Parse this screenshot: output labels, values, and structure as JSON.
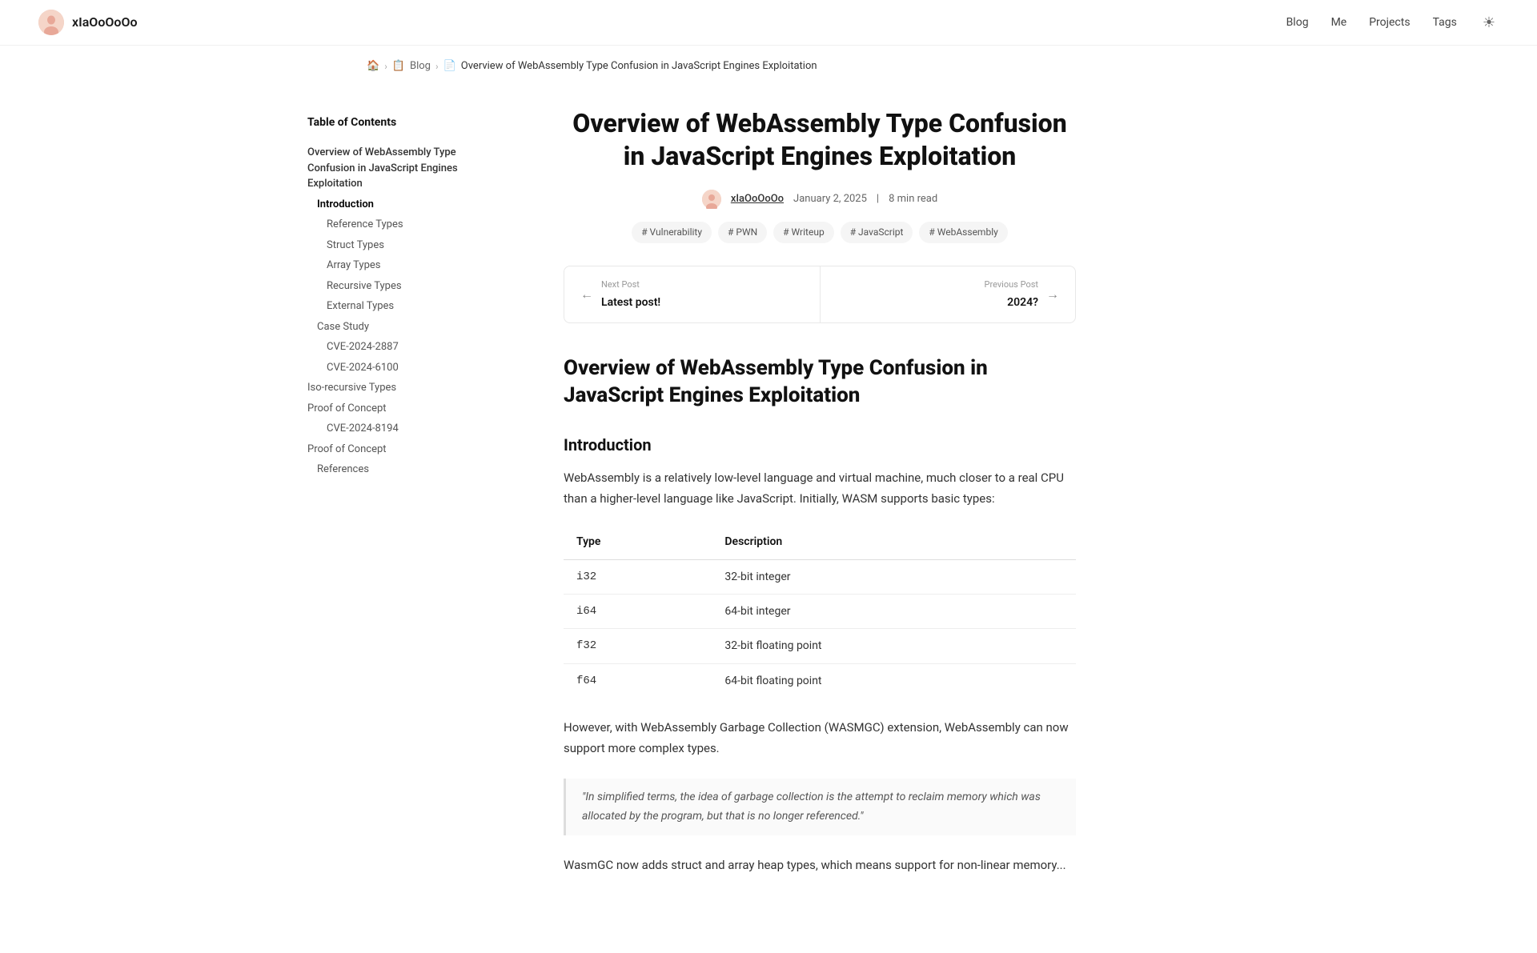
{
  "nav": {
    "brand": "xIaOoOoOo",
    "links": [
      "Blog",
      "Me",
      "Projects",
      "Tags"
    ],
    "theme_icon": "☀"
  },
  "breadcrumb": {
    "home_icon": "🏠",
    "blog_icon": "📋",
    "blog_label": "Blog",
    "page_icon": "📄",
    "page_label": "Overview of WebAssembly Type Confusion in JavaScript Engines Exploitation"
  },
  "article": {
    "title": "Overview of WebAssembly Type Confusion in JavaScript Engines Exploitation",
    "author": "xIaOoOoOo",
    "date": "January 2, 2025",
    "read_time": "8 min read",
    "tags": [
      "# Vulnerability",
      "# PWN",
      "# Writeup",
      "# JavaScript",
      "# WebAssembly"
    ],
    "next_post_label": "Next Post",
    "next_post_title": "Latest post!",
    "prev_post_label": "Previous Post",
    "prev_post_title": "2024?"
  },
  "toc": {
    "title": "Table of Contents",
    "items": [
      {
        "label": "Overview of WebAssembly Type Confusion in JavaScript Engines Exploitation",
        "level": 1
      },
      {
        "label": "Introduction",
        "level": 2,
        "active": true
      },
      {
        "label": "Reference Types",
        "level": 3
      },
      {
        "label": "Struct Types",
        "level": 3
      },
      {
        "label": "Array Types",
        "level": 3
      },
      {
        "label": "Recursive Types",
        "level": 3
      },
      {
        "label": "External Types",
        "level": 3
      },
      {
        "label": "Case Study",
        "level": 2
      },
      {
        "label": "CVE-2024-2887",
        "level": 3
      },
      {
        "label": "CVE-2024-6100",
        "level": 3
      },
      {
        "label": "Iso-recursive Types",
        "level": 4
      },
      {
        "label": "Proof of Concept",
        "level": 4
      },
      {
        "label": "CVE-2024-8194",
        "level": 3
      },
      {
        "label": "Proof of Concept",
        "level": 4
      },
      {
        "label": "References",
        "level": 2
      }
    ]
  },
  "body": {
    "article_heading": "Overview of WebAssembly Type Confusion in JavaScript Engines Exploitation",
    "intro_heading": "Introduction",
    "intro_para1": "WebAssembly is a relatively low-level language and virtual machine, much closer to a real CPU than a higher-level language like JavaScript. Initially, WASM supports basic types:",
    "table": {
      "headers": [
        "Type",
        "Description"
      ],
      "rows": [
        [
          "i32",
          "32-bit integer"
        ],
        [
          "i64",
          "64-bit integer"
        ],
        [
          "f32",
          "32-bit floating point"
        ],
        [
          "f64",
          "64-bit floating point"
        ]
      ]
    },
    "intro_para2": "However, with WebAssembly Garbage Collection (WASMGC) extension, WebAssembly can now support more complex types.",
    "blockquote": "\"In simplified terms, the idea of garbage collection is the attempt to reclaim memory which was allocated by the program, but that is no longer referenced.\"",
    "para3": "WasmGC now adds struct and array heap types, which means support for non-linear memory..."
  }
}
